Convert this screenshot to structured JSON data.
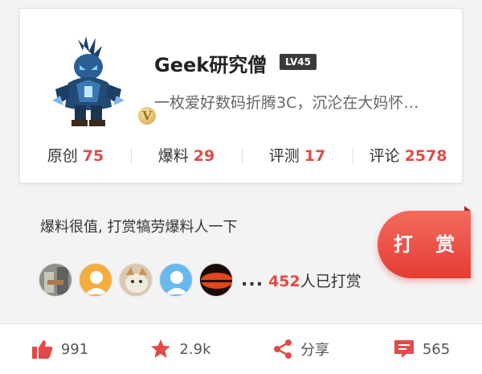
{
  "profile": {
    "name": "Geek研究僧",
    "level": "LV45",
    "badge": "V",
    "bio": "一枚爱好数码折腾3C，沉沦在大妈怀…"
  },
  "stats": [
    {
      "label": "原创",
      "value": "75"
    },
    {
      "label": "爆料",
      "value": "29"
    },
    {
      "label": "评测",
      "value": "17"
    },
    {
      "label": "评论",
      "value": "2578"
    }
  ],
  "tip": {
    "message": "爆料很值, 打赏犒劳爆料人一下",
    "button_label": "打 赏",
    "dots": "...",
    "count": "452",
    "count_suffix": "人已打赏"
  },
  "actions": {
    "like_count": "991",
    "favorite_count": "2.9k",
    "share_label": "分享",
    "comment_count": "565"
  },
  "colors": {
    "accent": "#e24a4a",
    "button": "#e63c34"
  }
}
